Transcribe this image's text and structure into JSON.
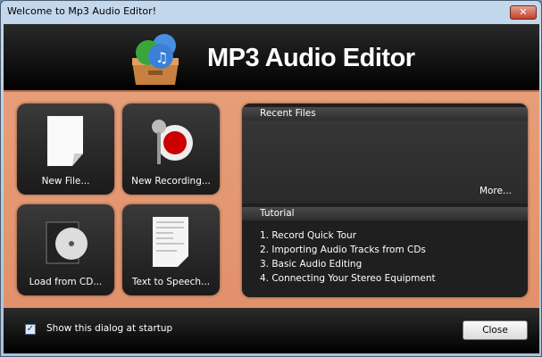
{
  "window": {
    "title": "Welcome to Mp3 Audio Editor!",
    "close_glyph": "✕"
  },
  "header": {
    "app_title": "MP3 Audio Editor"
  },
  "tiles": [
    {
      "label": "New File...",
      "icon": "blank-document-icon"
    },
    {
      "label": "New Recording...",
      "icon": "microphone-record-icon"
    },
    {
      "label": "Load from CD...",
      "icon": "cd-case-icon"
    },
    {
      "label": "Text to Speech...",
      "icon": "text-document-icon"
    }
  ],
  "recent_files": {
    "title": "Recent Files",
    "more": "More..."
  },
  "tutorial": {
    "title": "Tutorial",
    "items": [
      "1. Record Quick Tour",
      "2. Importing Audio Tracks from CDs",
      "3. Basic Audio Editing",
      "4. Connecting Your Stereo Equipment"
    ]
  },
  "footer": {
    "checkbox_label": "Show this dialog at startup",
    "checked": true,
    "check_glyph": "✓",
    "close_label": "Close"
  }
}
